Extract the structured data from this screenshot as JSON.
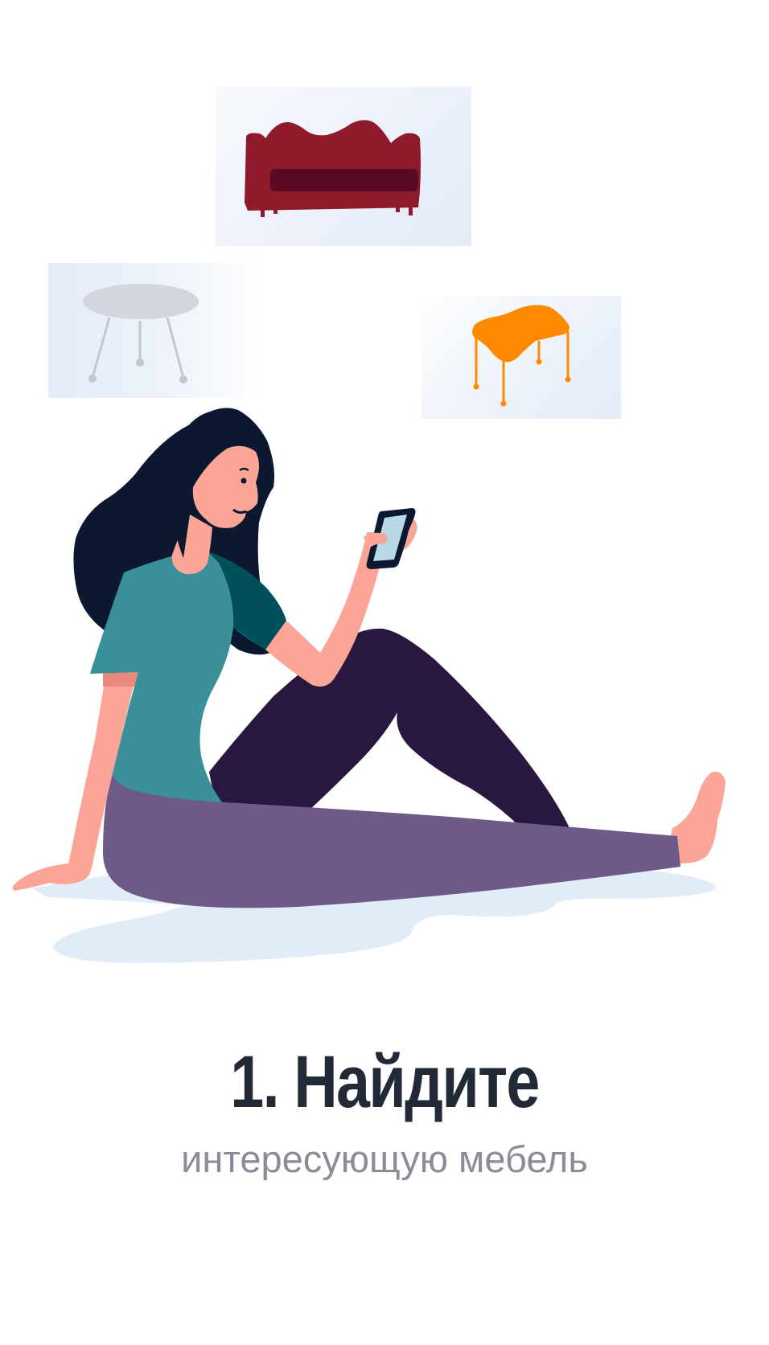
{
  "step": {
    "title": "1. Найдите",
    "subtitle": "интересующую мебель"
  },
  "illustration": {
    "cards": [
      {
        "item": "sofa-icon",
        "color": "#8f1a2b"
      },
      {
        "item": "round-table-icon",
        "color": "#d3d6dc"
      },
      {
        "item": "orange-table-icon",
        "color": "#ff8a00"
      }
    ],
    "colors": {
      "hair": "#0b1830",
      "skin": "#fba597",
      "shirt": "#3a8f99",
      "trousers": "#6e5a86",
      "knee": "#281840",
      "shadow": "#e2ebf8",
      "phone": "#b9d8e6"
    }
  }
}
